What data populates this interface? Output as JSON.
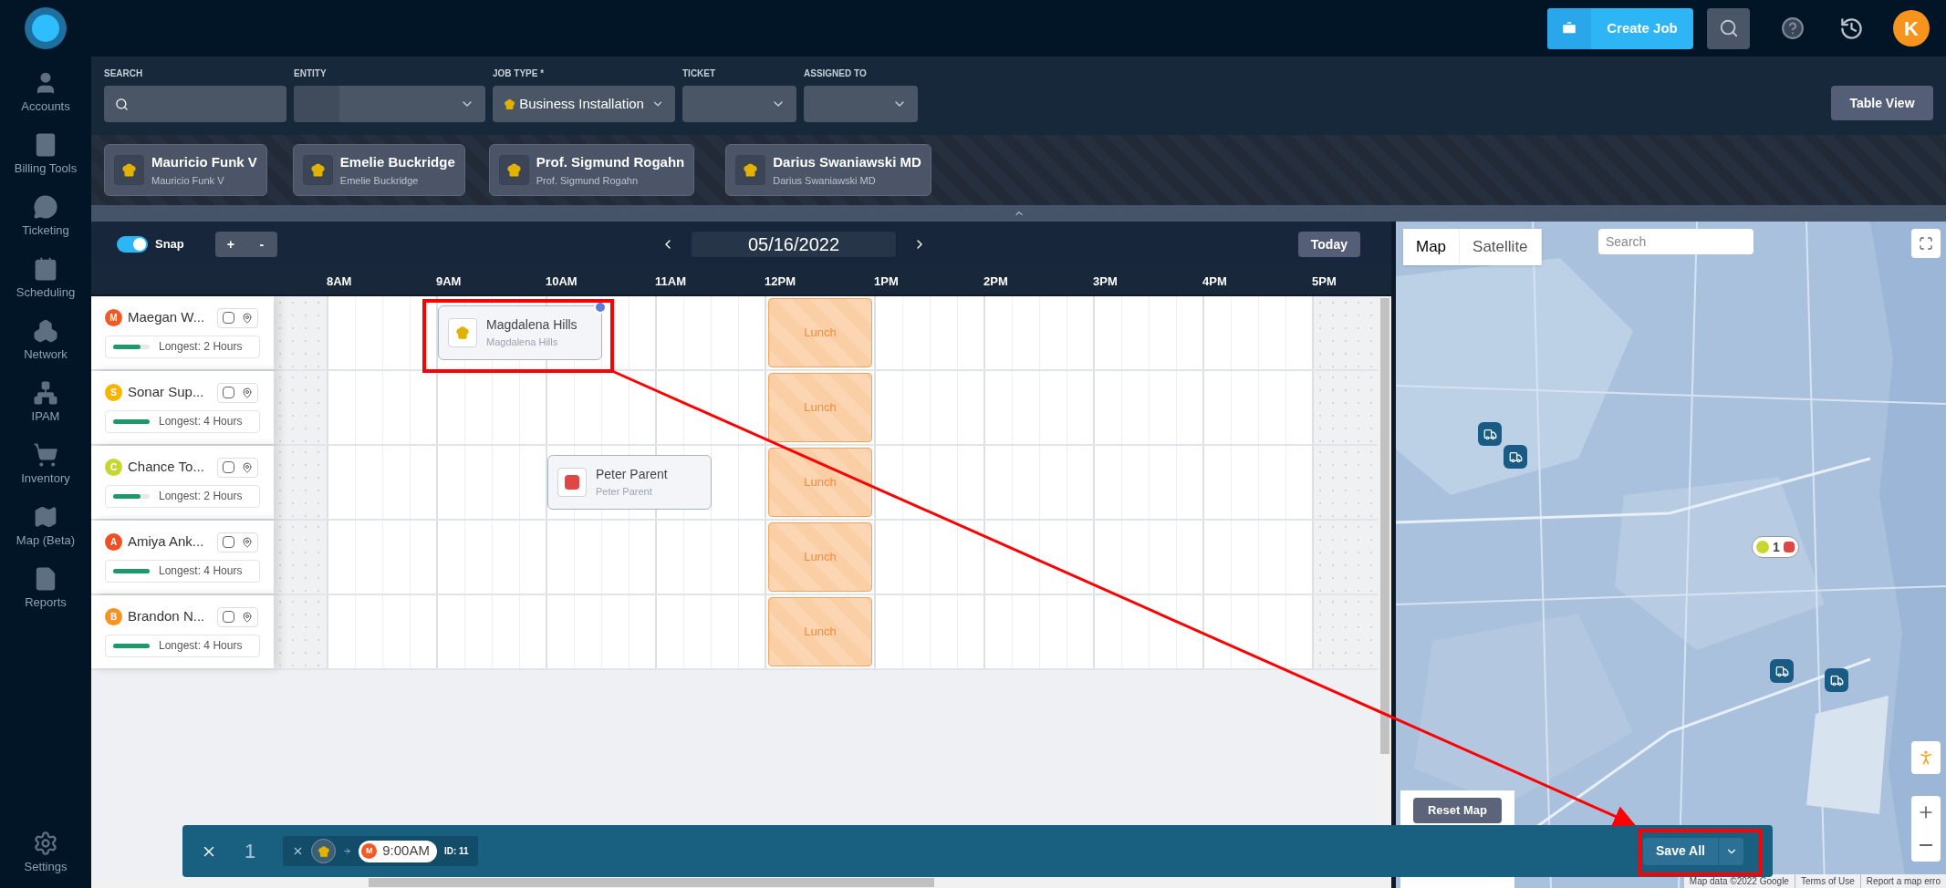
{
  "header": {
    "create_job": "Create Job",
    "avatar": "K"
  },
  "sidebar": {
    "items": [
      {
        "label": "Accounts",
        "kind": "accounts"
      },
      {
        "label": "Billing Tools",
        "kind": "billing"
      },
      {
        "label": "Ticketing",
        "kind": "ticketing"
      },
      {
        "label": "Scheduling",
        "kind": "scheduling"
      },
      {
        "label": "Network",
        "kind": "network"
      },
      {
        "label": "IPAM",
        "kind": "ipam"
      },
      {
        "label": "Inventory",
        "kind": "inventory"
      },
      {
        "label": "Map (Beta)",
        "kind": "map"
      },
      {
        "label": "Reports",
        "kind": "reports"
      }
    ],
    "settings": "Settings"
  },
  "filters": [
    {
      "label": "SEARCH",
      "kind": "search"
    },
    {
      "label": "ENTITY",
      "kind": "split"
    },
    {
      "label": "JOB TYPE *",
      "kind": "select",
      "value": "Business Installation"
    },
    {
      "label": "TICKET",
      "kind": "select"
    },
    {
      "label": "ASSIGNED TO",
      "kind": "select"
    }
  ],
  "table_view": "Table View",
  "technicians": [
    {
      "name": "Mauricio Funk V",
      "subtitle": "Mauricio Funk V"
    },
    {
      "name": "Emelie Buckridge",
      "subtitle": "Emelie Buckridge"
    },
    {
      "name": "Prof. Sigmund Rogahn",
      "subtitle": "Prof. Sigmund Rogahn"
    },
    {
      "name": "Darius Swaniawski MD",
      "subtitle": "Darius Swaniawski MD"
    }
  ],
  "toolbar": {
    "snap": {
      "label": "Snap",
      "on": true
    },
    "zoom_in": "+",
    "zoom_out": "-",
    "date": "05/16/2022",
    "today": "Today"
  },
  "hours": [
    "8AM",
    "9AM",
    "10AM",
    "11AM",
    "12PM",
    "1PM",
    "2PM",
    "3PM",
    "4PM",
    "5PM"
  ],
  "resources": [
    {
      "initial": "M",
      "name": "Maegan W...",
      "color": "#f15a24",
      "checked": false,
      "level": 0.75,
      "longest": "Longest: 2 Hours",
      "lunch": "Lunch",
      "jobs": [
        {
          "kind": "chef",
          "title": "Magdalena Hills",
          "subtitle": "Magdalena Hills",
          "pending": true
        }
      ]
    },
    {
      "initial": "S",
      "name": "Sonar Sup...",
      "color": "#f7b500",
      "checked": false,
      "level": 1,
      "longest": "Longest: 4 Hours",
      "lunch": "Lunch"
    },
    {
      "initial": "C",
      "name": "Chance To...",
      "color": "#c5d730",
      "checked": false,
      "level": 0.75,
      "longest": "Longest: 2 Hours",
      "lunch": "Lunch",
      "jobs": [
        {
          "kind": "stop",
          "title": "Peter Parent",
          "subtitle": "Peter Parent",
          "pending": false
        }
      ]
    },
    {
      "initial": "A",
      "name": "Amiya Ank...",
      "color": "#f04e23",
      "checked": false,
      "level": 1,
      "longest": "Longest: 4 Hours",
      "lunch": "Lunch"
    },
    {
      "initial": "B",
      "name": "Brandon N...",
      "color": "#f7931e",
      "checked": false,
      "level": 1,
      "longest": "Longest: 4 Hours",
      "lunch": "Lunch"
    }
  ],
  "map": {
    "tabs": [
      {
        "label": "Map",
        "selected": true
      },
      {
        "label": "Satellite",
        "selected": false
      }
    ],
    "search_placeholder": "Search",
    "cluster_count": "1",
    "reset": "Reset Map",
    "attribution": [
      "Map data ©2022 Google",
      "Terms of Use",
      "Report a map erro"
    ]
  },
  "changes": {
    "count": "1",
    "items": [
      {
        "initial": "M",
        "color": "#f15a24",
        "time": "9:00AM",
        "id": "ID: 11"
      }
    ],
    "save": "Save All"
  }
}
